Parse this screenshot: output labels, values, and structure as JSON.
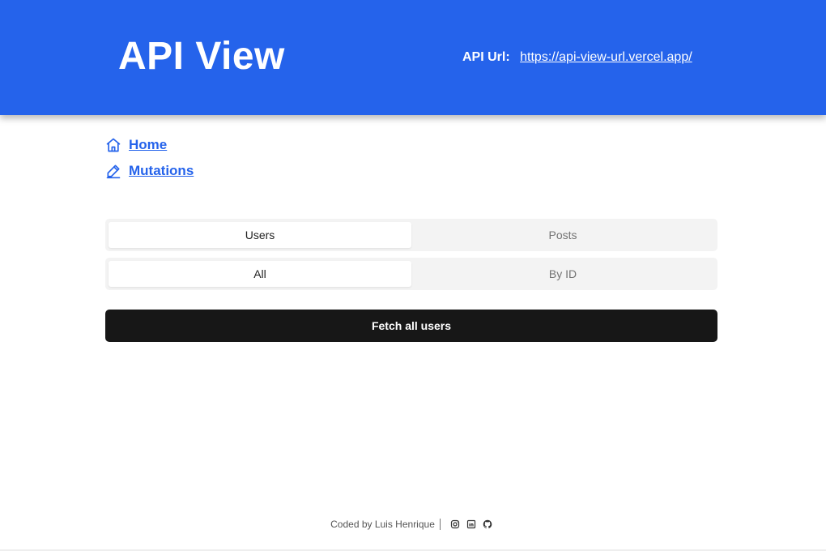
{
  "header": {
    "title": "API View",
    "api_url_label": "API Url:",
    "api_url": "https://api-view-url.vercel.app/"
  },
  "nav": {
    "items": [
      {
        "label": "Home",
        "icon": "home-icon"
      },
      {
        "label": "Mutations",
        "icon": "pencil-icon"
      }
    ]
  },
  "resource_tabs": {
    "items": [
      {
        "label": "Users",
        "active": true
      },
      {
        "label": "Posts",
        "active": false
      }
    ]
  },
  "mode_tabs": {
    "items": [
      {
        "label": "All",
        "active": true
      },
      {
        "label": "By ID",
        "active": false
      }
    ]
  },
  "action": {
    "fetch_label": "Fetch all users"
  },
  "footer": {
    "credit": "Coded by Luis Henrique",
    "social": [
      "instagram-icon",
      "linkedin-icon",
      "github-icon"
    ]
  },
  "colors": {
    "primary": "#2563eb",
    "button_bg": "#171717",
    "tab_bg": "#f3f3f3"
  }
}
